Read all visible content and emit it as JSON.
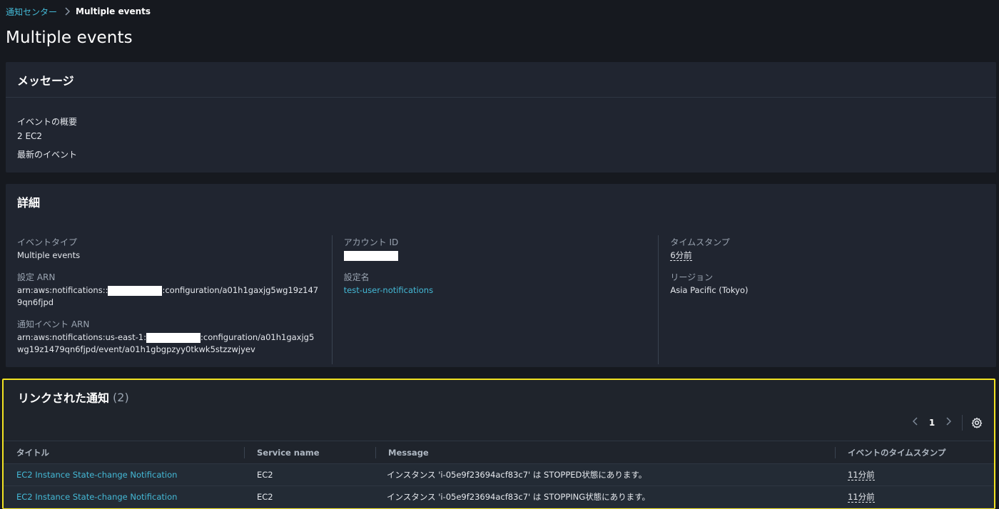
{
  "breadcrumb": {
    "parent": "通知センター",
    "current": "Multiple events"
  },
  "page": {
    "title": "Multiple events"
  },
  "message_panel": {
    "header": "メッセージ",
    "summary_label": "イベントの概要",
    "summary_value": "2 EC2",
    "latest_label": "最新のイベント"
  },
  "details_panel": {
    "header": "詳細",
    "event_type_label": "イベントタイプ",
    "event_type_value": "Multiple events",
    "config_arn_label": "設定 ARN",
    "config_arn_prefix": "arn:aws:notifications::",
    "config_arn_suffix": ":configuration/a01h1gaxjg5wg19z1479qn6fjpd",
    "event_arn_label": "通知イベント ARN",
    "event_arn_prefix": "arn:aws:notifications:us-east-1:",
    "event_arn_suffix": ":configuration/a01h1gaxjg5wg19z1479qn6fjpd/event/a01h1gbgpzyy0tkwk5stzzwjyev",
    "account_id_label": "アカウント ID",
    "config_name_label": "設定名",
    "config_name_value": "test-user-notifications",
    "timestamp_label": "タイムスタンプ",
    "timestamp_value": "6分前",
    "region_label": "リージョン",
    "region_value": "Asia Pacific (Tokyo)"
  },
  "linked_panel": {
    "header": "リンクされた通知",
    "count": "(2)",
    "pager": {
      "current_page": "1",
      "prev_icon": "chevron-left-icon",
      "next_icon": "chevron-right-icon",
      "settings_icon": "gear-icon"
    },
    "columns": {
      "title": "タイトル",
      "service": "Service name",
      "message": "Message",
      "timestamp": "イベントのタイムスタンプ"
    },
    "rows": [
      {
        "title": "EC2 Instance State-change Notification",
        "service": "EC2",
        "message": "インスタンス 'i-05e9f23694acf83c7' は STOPPED状態にあります。",
        "timestamp": "11分前"
      },
      {
        "title": "EC2 Instance State-change Notification",
        "service": "EC2",
        "message": "インスタンス 'i-05e9f23694acf83c7' は STOPPING状態にあります。",
        "timestamp": "11分前"
      }
    ]
  },
  "colors": {
    "background": "#16191f",
    "panel": "#202530",
    "link": "#44b9d6",
    "highlight_border": "#f2e322"
  }
}
